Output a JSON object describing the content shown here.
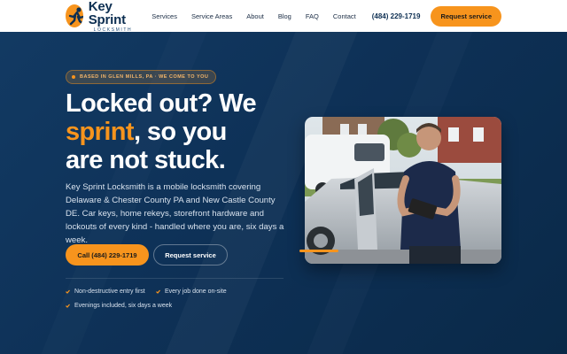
{
  "brand": {
    "name": "Key Sprint",
    "subtitle": "LOCKSMITH"
  },
  "nav": {
    "items": [
      "Services",
      "Service Areas",
      "About",
      "Blog",
      "FAQ",
      "Contact"
    ],
    "phone": "(484) 229-1719",
    "cta": "Request service"
  },
  "hero": {
    "badge": "BASED IN GLEN MILLS, PA · WE COME TO YOU",
    "headline_1": "Locked out? We",
    "headline_accent": "sprint",
    "headline_2": ", so you",
    "headline_3": "are not stuck.",
    "description": "Key Sprint Locksmith is a mobile locksmith covering Delaware & Chester County PA and New Castle County DE. Car keys, home rekeys, storefront hardware and lockouts of every kind - handled where you are, six days a week.",
    "primary_button": "Call (484) 229-1719",
    "secondary_button": "Request service",
    "features": [
      "Non-destructive entry first",
      "Every job done on-site",
      "Evenings included, six days a week"
    ]
  },
  "colors": {
    "accent": "#f7941d",
    "navy": "#0d2f52",
    "header_bg": "#ffffff"
  },
  "icons": {
    "logo": "running-man-key-icon",
    "feature": "check-tick-icon",
    "badge": "dot-icon"
  }
}
